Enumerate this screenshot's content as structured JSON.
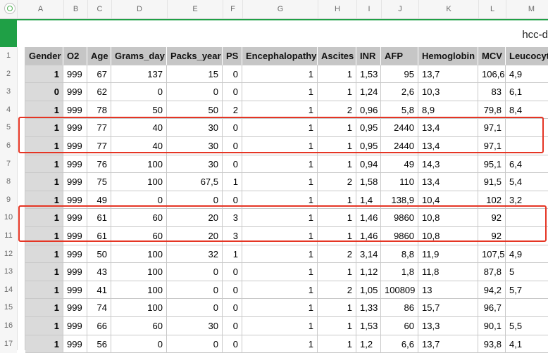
{
  "sheet_title": "hcc-d",
  "column_letters": [
    "A",
    "B",
    "C",
    "D",
    "E",
    "F",
    "G",
    "H",
    "I",
    "J",
    "K",
    "L",
    "M"
  ],
  "row_numbers": [
    "1",
    "2",
    "3",
    "4",
    "5",
    "6",
    "7",
    "8",
    "9",
    "10",
    "11",
    "12",
    "13",
    "14",
    "15",
    "16",
    "17"
  ],
  "headers": [
    "Gender",
    "O2",
    "Age",
    "Grams_day",
    "Packs_year",
    "PS",
    "Encephalopathy",
    "Ascites",
    "INR",
    "AFP",
    "Hemoglobin",
    "MCV",
    "Leucocyt"
  ],
  "rows": [
    [
      "1",
      "999",
      "67",
      "137",
      "15",
      "0",
      "1",
      "1",
      "1,53",
      "95",
      "13,7",
      "106,6",
      "4,9"
    ],
    [
      "0",
      "999",
      "62",
      "0",
      "0",
      "0",
      "1",
      "1",
      "1,24",
      "2,6",
      "10,3",
      "83",
      "6,1"
    ],
    [
      "1",
      "999",
      "78",
      "50",
      "50",
      "2",
      "1",
      "2",
      "0,96",
      "5,8",
      "8,9",
      "79,8",
      "8,4"
    ],
    [
      "1",
      "999",
      "77",
      "40",
      "30",
      "0",
      "1",
      "1",
      "0,95",
      "2440",
      "13,4",
      "97,1",
      ""
    ],
    [
      "1",
      "999",
      "77",
      "40",
      "30",
      "0",
      "1",
      "1",
      "0,95",
      "2440",
      "13,4",
      "97,1",
      ""
    ],
    [
      "1",
      "999",
      "76",
      "100",
      "30",
      "0",
      "1",
      "1",
      "0,94",
      "49",
      "14,3",
      "95,1",
      "6,4"
    ],
    [
      "1",
      "999",
      "75",
      "100",
      "67,5",
      "1",
      "1",
      "2",
      "1,58",
      "110",
      "13,4",
      "91,5",
      "5,4"
    ],
    [
      "1",
      "999",
      "49",
      "0",
      "0",
      "0",
      "1",
      "1",
      "1,4",
      "138,9",
      "10,4",
      "102",
      "3,2"
    ],
    [
      "1",
      "999",
      "61",
      "60",
      "20",
      "3",
      "1",
      "1",
      "1,46",
      "9860",
      "10,8",
      "92",
      ""
    ],
    [
      "1",
      "999",
      "61",
      "60",
      "20",
      "3",
      "1",
      "1",
      "1,46",
      "9860",
      "10,8",
      "92",
      ""
    ],
    [
      "1",
      "999",
      "50",
      "100",
      "32",
      "1",
      "1",
      "2",
      "3,14",
      "8,8",
      "11,9",
      "107,5",
      "4,9"
    ],
    [
      "1",
      "999",
      "43",
      "100",
      "0",
      "0",
      "1",
      "1",
      "1,12",
      "1,8",
      "11,8",
      "87,8",
      "5"
    ],
    [
      "1",
      "999",
      "41",
      "100",
      "0",
      "0",
      "1",
      "2",
      "1,05",
      "100809",
      "13",
      "94,2",
      "5,7"
    ],
    [
      "1",
      "999",
      "74",
      "100",
      "0",
      "0",
      "1",
      "1",
      "1,33",
      "86",
      "15,7",
      "96,7",
      ""
    ],
    [
      "1",
      "999",
      "66",
      "60",
      "30",
      "0",
      "1",
      "1",
      "1,53",
      "60",
      "13,3",
      "90,1",
      "5,5"
    ],
    [
      "1",
      "999",
      "56",
      "0",
      "0",
      "0",
      "1",
      "1",
      "1,2",
      "6,6",
      "13,7",
      "93,8",
      "4,1"
    ]
  ],
  "highlight_color": "#e53524",
  "accent_color": "#1fa046"
}
